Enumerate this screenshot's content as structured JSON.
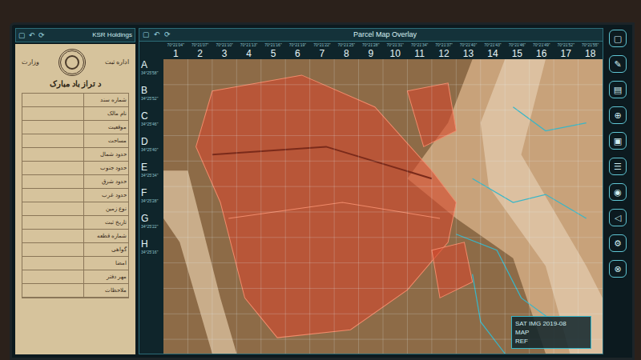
{
  "doc_panel": {
    "toolbar": [
      "▢",
      "↶",
      "⟳"
    ],
    "title": "KSR Holdings",
    "header_left": "وزارت",
    "header_right": "اداره ثبت",
    "heading": "د تراز باد مبارک",
    "rows": [
      "شماره سند",
      "نام مالک",
      "موقعیت",
      "مساحت",
      "حدود شمال",
      "حدود جنوب",
      "حدود شرق",
      "حدود غرب",
      "نوع زمین",
      "تاریخ ثبت",
      "شماره قطعه",
      "گواهی",
      "امضا",
      "مهر دفتر",
      "ملاحظات"
    ]
  },
  "map_panel": {
    "toolbar": [
      "▢",
      "↶",
      "⟳"
    ],
    "title": "Parcel Map Overlay",
    "columns": [
      {
        "label": "1",
        "coord": "70°21'04\""
      },
      {
        "label": "2",
        "coord": "70°21'07\""
      },
      {
        "label": "3",
        "coord": "70°21'10\""
      },
      {
        "label": "4",
        "coord": "70°21'13\""
      },
      {
        "label": "5",
        "coord": "70°21'16\""
      },
      {
        "label": "6",
        "coord": "70°21'19\""
      },
      {
        "label": "7",
        "coord": "70°21'22\""
      },
      {
        "label": "8",
        "coord": "70°21'25\""
      },
      {
        "label": "9",
        "coord": "70°21'28\""
      },
      {
        "label": "10",
        "coord": "70°21'31\""
      },
      {
        "label": "11",
        "coord": "70°21'34\""
      },
      {
        "label": "12",
        "coord": "70°21'37\""
      },
      {
        "label": "13",
        "coord": "70°21'40\""
      },
      {
        "label": "14",
        "coord": "70°21'43\""
      },
      {
        "label": "15",
        "coord": "70°21'46\""
      },
      {
        "label": "16",
        "coord": "70°21'49\""
      },
      {
        "label": "17",
        "coord": "70°21'52\""
      },
      {
        "label": "18",
        "coord": "70°21'55\""
      }
    ],
    "rows": [
      {
        "label": "A",
        "coord": "34°25'58\""
      },
      {
        "label": "B",
        "coord": "34°25'52\""
      },
      {
        "label": "C",
        "coord": "34°25'46\""
      },
      {
        "label": "D",
        "coord": "34°25'40\""
      },
      {
        "label": "E",
        "coord": "34°25'34\""
      },
      {
        "label": "F",
        "coord": "34°25'28\""
      },
      {
        "label": "G",
        "coord": "34°25'22\""
      },
      {
        "label": "H",
        "coord": "34°25'16\""
      }
    ],
    "inset": [
      "SAT IMG 2019-08",
      "MAP",
      "REF"
    ]
  },
  "toolbar": [
    "▢",
    "✎",
    "▤",
    "⊕",
    "▣",
    "☰",
    "◉",
    "◁",
    "⚙",
    "⊗"
  ]
}
